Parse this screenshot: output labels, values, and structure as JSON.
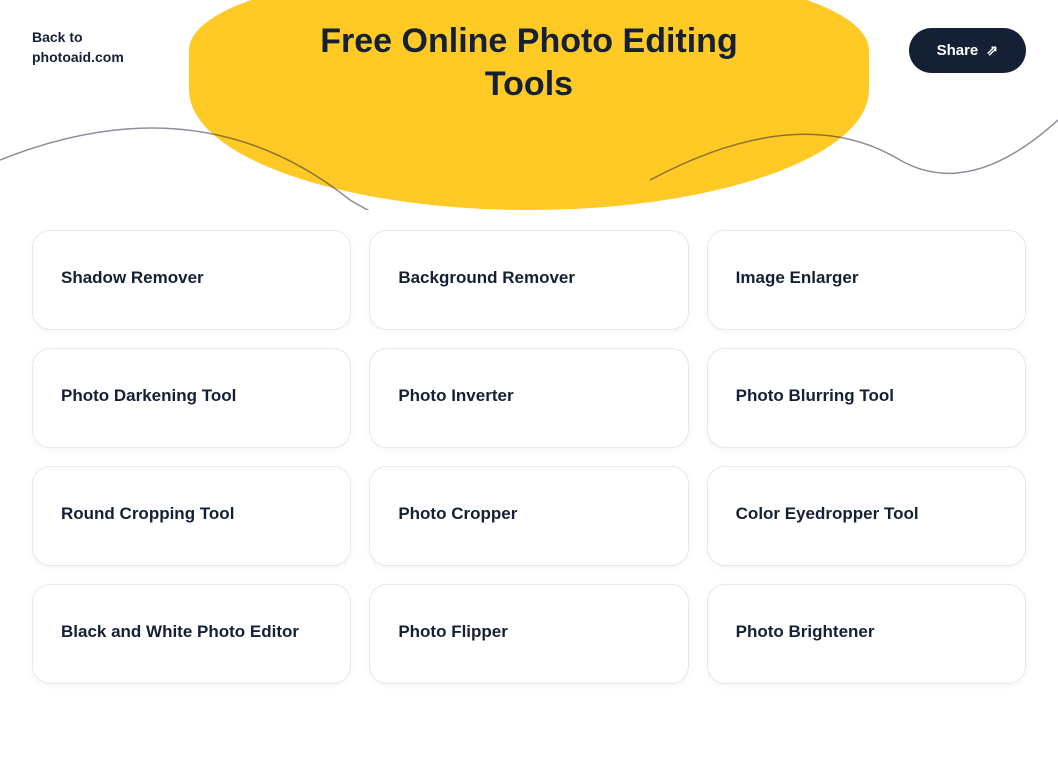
{
  "header": {
    "back_label": "Back to\nphotoaid.com",
    "title": "Free Online Photo Editing Tools",
    "share_label": "Share"
  },
  "tools": [
    {
      "id": "shadow-remover",
      "label": "Shadow Remover"
    },
    {
      "id": "background-remover",
      "label": "Background Remover"
    },
    {
      "id": "image-enlarger",
      "label": "Image Enlarger"
    },
    {
      "id": "photo-darkening-tool",
      "label": "Photo Darkening Tool"
    },
    {
      "id": "photo-inverter",
      "label": "Photo Inverter"
    },
    {
      "id": "photo-blurring-tool",
      "label": "Photo Blurring Tool"
    },
    {
      "id": "round-cropping-tool",
      "label": "Round Cropping Tool"
    },
    {
      "id": "photo-cropper",
      "label": "Photo Cropper"
    },
    {
      "id": "color-eyedropper-tool",
      "label": "Color Eyedropper Tool"
    },
    {
      "id": "black-and-white-photo-editor",
      "label": "Black and White Photo Editor"
    },
    {
      "id": "photo-flipper",
      "label": "Photo Flipper"
    },
    {
      "id": "photo-brightener",
      "label": "Photo Brightener"
    }
  ]
}
